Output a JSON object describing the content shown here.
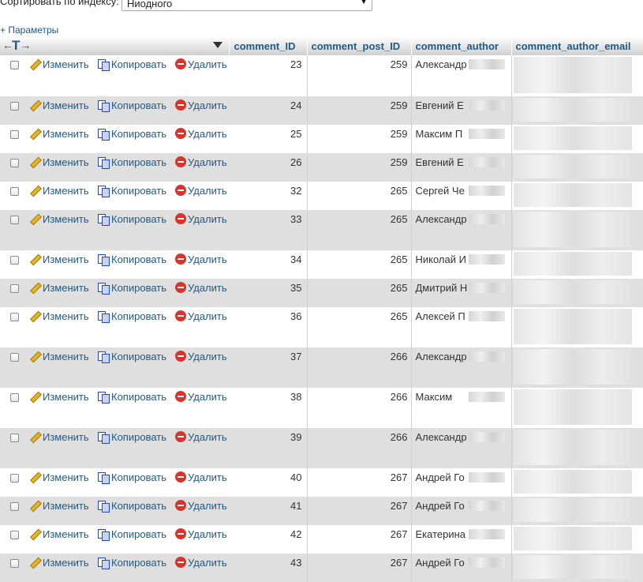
{
  "sort": {
    "label": "Сортировать по индексу:",
    "value": "Ниодного"
  },
  "params_label": "+ Параметры",
  "actions": {
    "edit": "Изменить",
    "copy": "Копировать",
    "delete": "Удалить"
  },
  "columns": [
    "comment_ID",
    "comment_post_ID",
    "comment_author",
    "comment_author_email"
  ],
  "rows": [
    {
      "id": "23",
      "post": "259",
      "author": "Александр",
      "h": 52
    },
    {
      "id": "24",
      "post": "259",
      "author": "Евгений Е",
      "h": 36
    },
    {
      "id": "25",
      "post": "259",
      "author": "Максим П",
      "h": 36
    },
    {
      "id": "26",
      "post": "259",
      "author": "Евгений Е",
      "h": 36
    },
    {
      "id": "32",
      "post": "265",
      "author": "Сергей Че",
      "h": 36
    },
    {
      "id": "33",
      "post": "265",
      "author": "Александр",
      "h": 51
    },
    {
      "id": "34",
      "post": "265",
      "author": "Николай И",
      "h": 36
    },
    {
      "id": "35",
      "post": "265",
      "author": "Дмитрий Н",
      "h": 36
    },
    {
      "id": "36",
      "post": "265",
      "author": "Алексей П",
      "h": 51
    },
    {
      "id": "37",
      "post": "266",
      "author": "Александр",
      "h": 51
    },
    {
      "id": "38",
      "post": "266",
      "author": "Максим",
      "h": 51
    },
    {
      "id": "39",
      "post": "266",
      "author": "Александр",
      "h": 51
    },
    {
      "id": "40",
      "post": "267",
      "author": "Андрей Го",
      "h": 36
    },
    {
      "id": "41",
      "post": "267",
      "author": "Андрей Го",
      "h": 36
    },
    {
      "id": "42",
      "post": "267",
      "author": "Екатерина",
      "h": 36
    },
    {
      "id": "43",
      "post": "267",
      "author": "Андрей Го",
      "h": 36
    }
  ]
}
